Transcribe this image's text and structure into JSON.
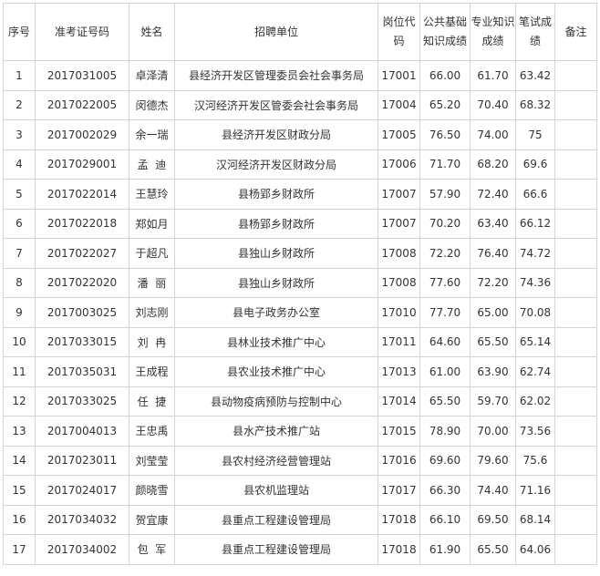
{
  "table": {
    "headers": {
      "seq": "序号",
      "exam_no": "准考证号码",
      "name": "姓名",
      "unit": "招聘单位",
      "post_code": "岗位代码",
      "basic_score": "公共基础知识成绩",
      "prof_score": "专业知识成绩",
      "written_score": "笔试成绩",
      "remark": "备注"
    },
    "rows": [
      {
        "seq": "1",
        "exam_no": "2017031005",
        "name": "卓泽清",
        "unit": "县经济开发区管理委员会社会事务局",
        "post_code": "17001",
        "basic_score": "66.00",
        "prof_score": "61.70",
        "written_score": "63.42",
        "remark": ""
      },
      {
        "seq": "2",
        "exam_no": "2017022005",
        "name": "闵德杰",
        "unit": "汉河经济开发区管委会社会事务局",
        "post_code": "17004",
        "basic_score": "65.20",
        "prof_score": "70.40",
        "written_score": "68.32",
        "remark": ""
      },
      {
        "seq": "3",
        "exam_no": "2017002029",
        "name": "余一瑞",
        "unit": "县经济开发区财政分局",
        "post_code": "17005",
        "basic_score": "76.50",
        "prof_score": "74.00",
        "written_score": "75",
        "remark": ""
      },
      {
        "seq": "4",
        "exam_no": "2017029001",
        "name": "孟  迪",
        "unit": "汉河经济开发区财政分局",
        "post_code": "17006",
        "basic_score": "71.70",
        "prof_score": "68.20",
        "written_score": "69.6",
        "remark": ""
      },
      {
        "seq": "5",
        "exam_no": "2017022014",
        "name": "王慧玲",
        "unit": "县杨郢乡财政所",
        "post_code": "17007",
        "basic_score": "57.90",
        "prof_score": "72.40",
        "written_score": "66.6",
        "remark": ""
      },
      {
        "seq": "6",
        "exam_no": "2017022018",
        "name": "郑如月",
        "unit": "县杨郢乡财政所",
        "post_code": "17007",
        "basic_score": "70.20",
        "prof_score": "63.40",
        "written_score": "66.12",
        "remark": ""
      },
      {
        "seq": "7",
        "exam_no": "2017022027",
        "name": "于超凡",
        "unit": "县独山乡财政所",
        "post_code": "17008",
        "basic_score": "72.20",
        "prof_score": "76.40",
        "written_score": "74.72",
        "remark": ""
      },
      {
        "seq": "8",
        "exam_no": "2017022020",
        "name": "潘  丽",
        "unit": "县独山乡财政所",
        "post_code": "17008",
        "basic_score": "77.60",
        "prof_score": "72.20",
        "written_score": "74.36",
        "remark": ""
      },
      {
        "seq": "9",
        "exam_no": "2017003025",
        "name": "刘志刚",
        "unit": "县电子政务办公室",
        "post_code": "17010",
        "basic_score": "77.70",
        "prof_score": "65.00",
        "written_score": "70.08",
        "remark": ""
      },
      {
        "seq": "10",
        "exam_no": "2017033015",
        "name": "刘  冉",
        "unit": "县林业技术推广中心",
        "post_code": "17011",
        "basic_score": "64.60",
        "prof_score": "65.50",
        "written_score": "65.14",
        "remark": ""
      },
      {
        "seq": "11",
        "exam_no": "2017035031",
        "name": "王成程",
        "unit": "县农业技术推广中心",
        "post_code": "17013",
        "basic_score": "61.00",
        "prof_score": "63.90",
        "written_score": "62.74",
        "remark": ""
      },
      {
        "seq": "12",
        "exam_no": "2017033025",
        "name": "任  捷",
        "unit": "县动物疫病预防与控制中心",
        "post_code": "17014",
        "basic_score": "65.50",
        "prof_score": "59.70",
        "written_score": "62.02",
        "remark": ""
      },
      {
        "seq": "13",
        "exam_no": "2017004013",
        "name": "王忠禹",
        "unit": "县水产技术推广站",
        "post_code": "17015",
        "basic_score": "78.90",
        "prof_score": "70.00",
        "written_score": "73.56",
        "remark": ""
      },
      {
        "seq": "14",
        "exam_no": "2017023011",
        "name": "刘莹莹",
        "unit": "县农村经济经营管理站",
        "post_code": "17016",
        "basic_score": "69.60",
        "prof_score": "79.60",
        "written_score": "75.6",
        "remark": ""
      },
      {
        "seq": "15",
        "exam_no": "2017024017",
        "name": "颜晓雪",
        "unit": "县农机监理站",
        "post_code": "17017",
        "basic_score": "66.30",
        "prof_score": "74.40",
        "written_score": "71.16",
        "remark": ""
      },
      {
        "seq": "16",
        "exam_no": "2017034032",
        "name": "贺宜康",
        "unit": "县重点工程建设管理局",
        "post_code": "17018",
        "basic_score": "66.10",
        "prof_score": "69.50",
        "written_score": "68.14",
        "remark": ""
      },
      {
        "seq": "17",
        "exam_no": "2017034002",
        "name": "包  军",
        "unit": "县重点工程建设管理局",
        "post_code": "17018",
        "basic_score": "61.90",
        "prof_score": "65.50",
        "written_score": "64.06",
        "remark": ""
      }
    ]
  }
}
